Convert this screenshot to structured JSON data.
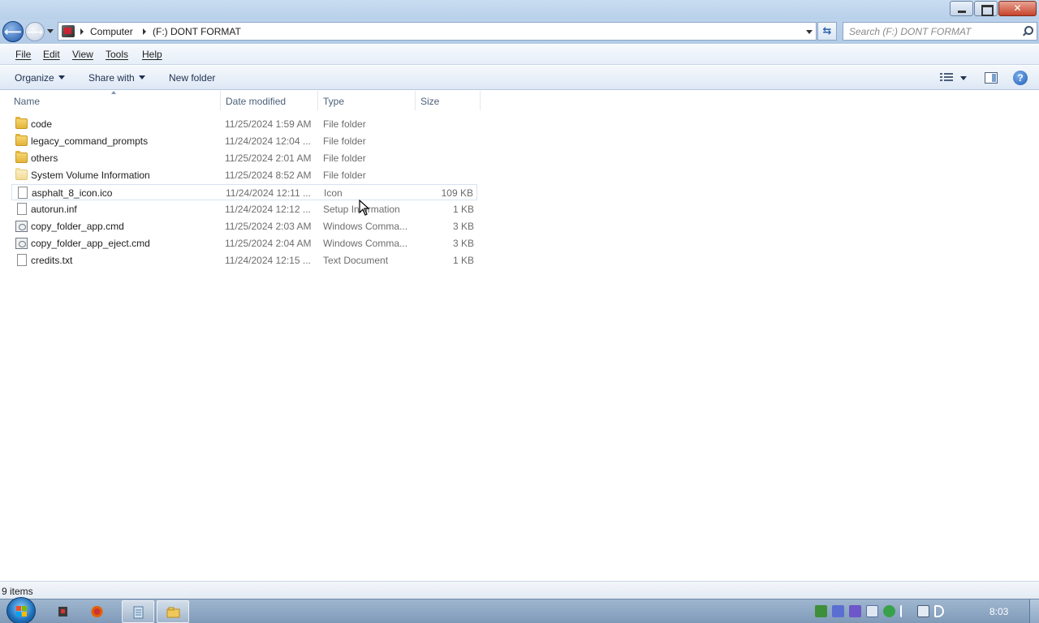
{
  "window": {
    "caption_buttons": [
      "minimize",
      "maximize",
      "close"
    ]
  },
  "address_bar": {
    "crumbs": [
      "Computer",
      "(F:) DONT FORMAT"
    ]
  },
  "search": {
    "placeholder": "Search (F:) DONT FORMAT"
  },
  "menu": {
    "file": "File",
    "edit": "Edit",
    "view": "View",
    "tools": "Tools",
    "help": "Help"
  },
  "toolbar": {
    "organize": "Organize",
    "share_with": "Share with",
    "new_folder": "New folder"
  },
  "columns": {
    "name": "Name",
    "date_modified": "Date modified",
    "type": "Type",
    "size": "Size"
  },
  "files": [
    {
      "name": "code",
      "date": "11/25/2024 1:59 AM",
      "type": "File folder",
      "size": "",
      "icon": "folder-icon"
    },
    {
      "name": "legacy_command_prompts",
      "date": "11/24/2024 12:04 ...",
      "type": "File folder",
      "size": "",
      "icon": "folder-icon"
    },
    {
      "name": "others",
      "date": "11/25/2024 2:01 AM",
      "type": "File folder",
      "size": "",
      "icon": "folder-icon"
    },
    {
      "name": "System Volume Information",
      "date": "11/25/2024 8:52 AM",
      "type": "File folder",
      "size": "",
      "icon": "folder-icon"
    },
    {
      "name": "asphalt_8_icon.ico",
      "date": "11/24/2024 12:11 ...",
      "type": "Icon",
      "size": "109 KB",
      "icon": "file-icon"
    },
    {
      "name": "autorun.inf",
      "date": "11/24/2024 12:12 ...",
      "type": "Setup Information",
      "size": "1 KB",
      "icon": "file-icon"
    },
    {
      "name": "copy_folder_app.cmd",
      "date": "11/25/2024 2:03 AM",
      "type": "Windows Comma...",
      "size": "3 KB",
      "icon": "cmd-file-icon"
    },
    {
      "name": "copy_folder_app_eject.cmd",
      "date": "11/25/2024 2:04 AM",
      "type": "Windows Comma...",
      "size": "3 KB",
      "icon": "cmd-file-icon"
    },
    {
      "name": "credits.txt",
      "date": "11/24/2024 12:15 ...",
      "type": "Text Document",
      "size": "1 KB",
      "icon": "file-icon"
    }
  ],
  "status": {
    "item_count": "9 items"
  },
  "taskbar": {
    "clock": "8:03",
    "pinned": [
      "app-icon",
      "firefox-icon",
      "notepad-icon",
      "explorer-icon"
    ]
  },
  "colors": {
    "titlebar": "#c9dcf1",
    "selection_border": "#d7e3f0",
    "taskbar": "#8fa8c5",
    "folder": "#e4b33a"
  }
}
